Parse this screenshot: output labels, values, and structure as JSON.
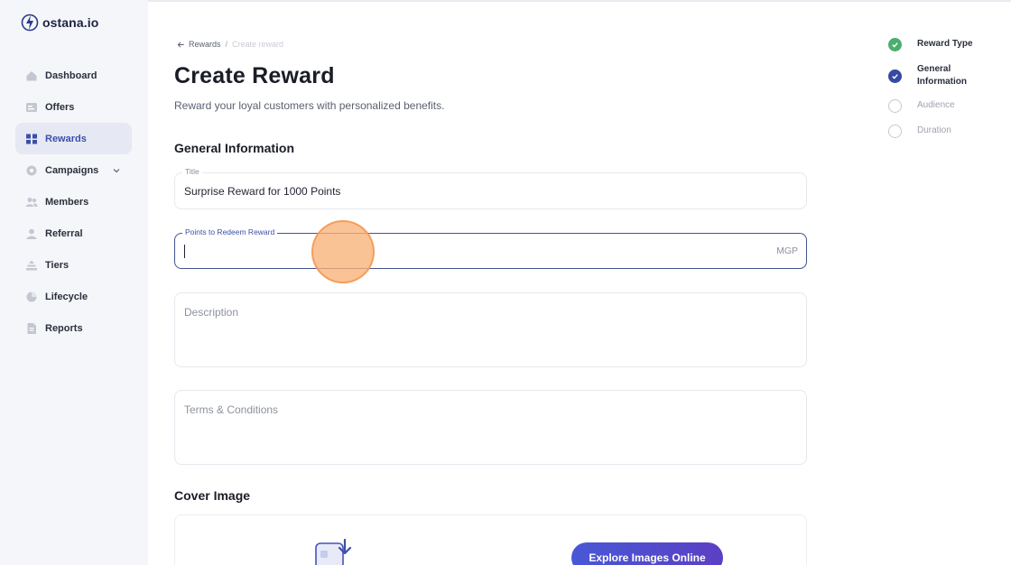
{
  "brand": {
    "name": "ostana.io"
  },
  "sidebar": {
    "items": [
      {
        "label": "Dashboard",
        "icon": "home-icon"
      },
      {
        "label": "Offers",
        "icon": "offers-icon"
      },
      {
        "label": "Rewards",
        "icon": "rewards-icon",
        "active": true
      },
      {
        "label": "Campaigns",
        "icon": "campaigns-icon",
        "has_submenu": true
      },
      {
        "label": "Members",
        "icon": "members-icon"
      },
      {
        "label": "Referral",
        "icon": "referral-icon"
      },
      {
        "label": "Tiers",
        "icon": "tiers-icon"
      },
      {
        "label": "Lifecycle",
        "icon": "lifecycle-icon"
      },
      {
        "label": "Reports",
        "icon": "reports-icon"
      }
    ]
  },
  "breadcrumb": {
    "back": "Rewards",
    "separator": "/",
    "current": "Create reward"
  },
  "page": {
    "title": "Create Reward",
    "subtitle": "Reward your loyal customers with personalized benefits."
  },
  "general": {
    "heading": "General Information",
    "title_field": {
      "label": "Title",
      "value": "Surprise Reward for 1000 Points"
    },
    "points_field": {
      "label": "Points to Redeem Reward",
      "value": "",
      "suffix": "MGP"
    },
    "description_field": {
      "placeholder": "Description"
    },
    "terms_field": {
      "placeholder": "Terms & Conditions"
    }
  },
  "cover": {
    "heading": "Cover Image",
    "explore_button": "Explore Images Online"
  },
  "steps": [
    {
      "label": "Reward Type",
      "state": "done"
    },
    {
      "label": "General Information",
      "state": "current"
    },
    {
      "label": "Audience",
      "state": "pending"
    },
    {
      "label": "Duration",
      "state": "pending"
    }
  ],
  "colors": {
    "accent": "#3c4fa8",
    "done": "#4cae6e",
    "button_gradient_start": "#4858d6",
    "button_gradient_end": "#5b3fc4",
    "click_indicator": "#f9b278"
  }
}
